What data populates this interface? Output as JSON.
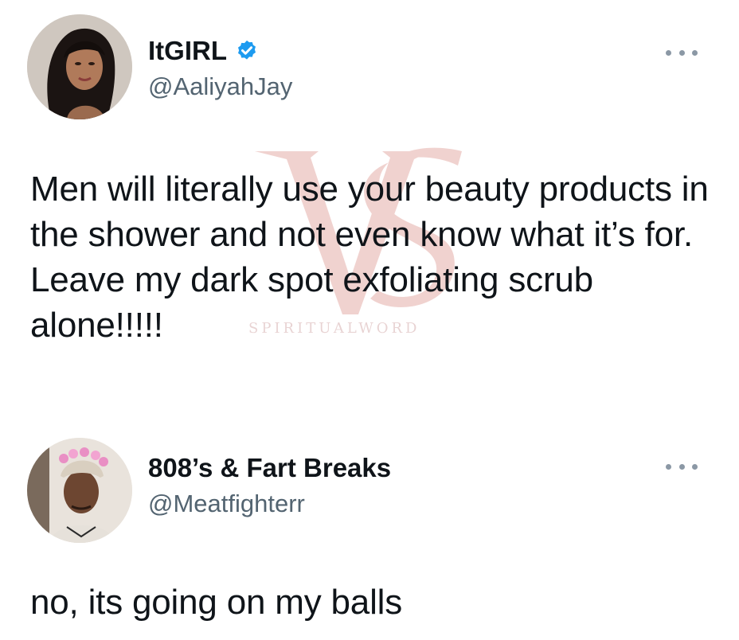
{
  "tweets": [
    {
      "display_name": "ItGIRL",
      "verified": true,
      "verified_icon": "verified-badge-icon",
      "handle": "@AaliyahJay",
      "more_icon": "more-options-icon",
      "text": "Men will literally use your beauty products in the shower and not even know what it’s for. Leave my dark spot exfoliating scrub alone!!!!!"
    },
    {
      "display_name": "808’s & Fart Breaks",
      "verified": false,
      "handle": "@Meatfighterr",
      "more_icon": "more-options-icon",
      "text": "no, its going on my balls"
    }
  ],
  "watermark": {
    "text": "SPIRITUALWORD",
    "color": "#c0392b"
  },
  "colors": {
    "text_primary": "#0f1419",
    "text_secondary": "#536471",
    "verified_blue": "#1d9bf0"
  }
}
